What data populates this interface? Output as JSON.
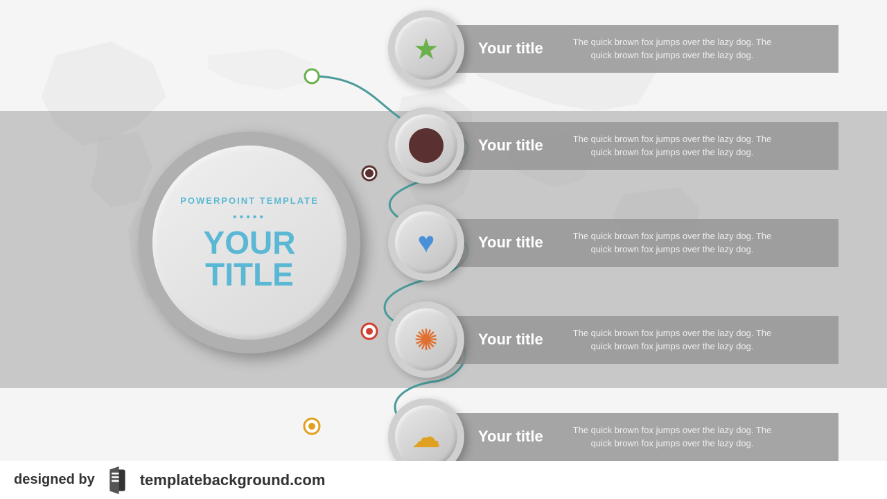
{
  "background": {
    "grayBandColor": "#c8c8c8",
    "topColor": "#f5f5f5",
    "bottomColor": "#f5f5f5"
  },
  "mainCircle": {
    "subtitle": "POWERPOINT TEMPLATE",
    "dots": "•••••",
    "title": "YOUR\nTITLE"
  },
  "items": [
    {
      "id": 1,
      "title": "Your title",
      "description": "The quick brown fox jumps over the lazy dog. The quick brown fox jumps over the lazy dog.",
      "icon": "star",
      "nodeColor": "#6ab04c",
      "topPx": 15
    },
    {
      "id": 2,
      "title": "Your title",
      "description": "The quick brown fox jumps over the lazy dog. The quick brown fox jumps over the lazy dog.",
      "icon": "circle-brown",
      "nodeColor": "#5a3030",
      "topPx": 155
    },
    {
      "id": 3,
      "title": "Your title",
      "description": "The quick brown fox jumps over the lazy dog. The quick brown fox jumps over the lazy dog.",
      "icon": "heart",
      "nodeColor": "#4a90d9",
      "topPx": 295
    },
    {
      "id": 4,
      "title": "Your title",
      "description": "The quick brown fox jumps over the lazy dog. The quick brown fox jumps over the lazy dog.",
      "icon": "sun",
      "nodeColor": "#e07030",
      "topPx": 435
    },
    {
      "id": 5,
      "title": "Your title",
      "description": "The quick brown fox jumps over the lazy dog. The quick brown fox jumps over the lazy dog.",
      "icon": "blob",
      "nodeColor": "#e0a020",
      "topPx": 575
    }
  ],
  "footer": {
    "designedBy": "designed by",
    "url": "templatebackground.com"
  },
  "curve": {
    "color": "#4a9a9a"
  }
}
